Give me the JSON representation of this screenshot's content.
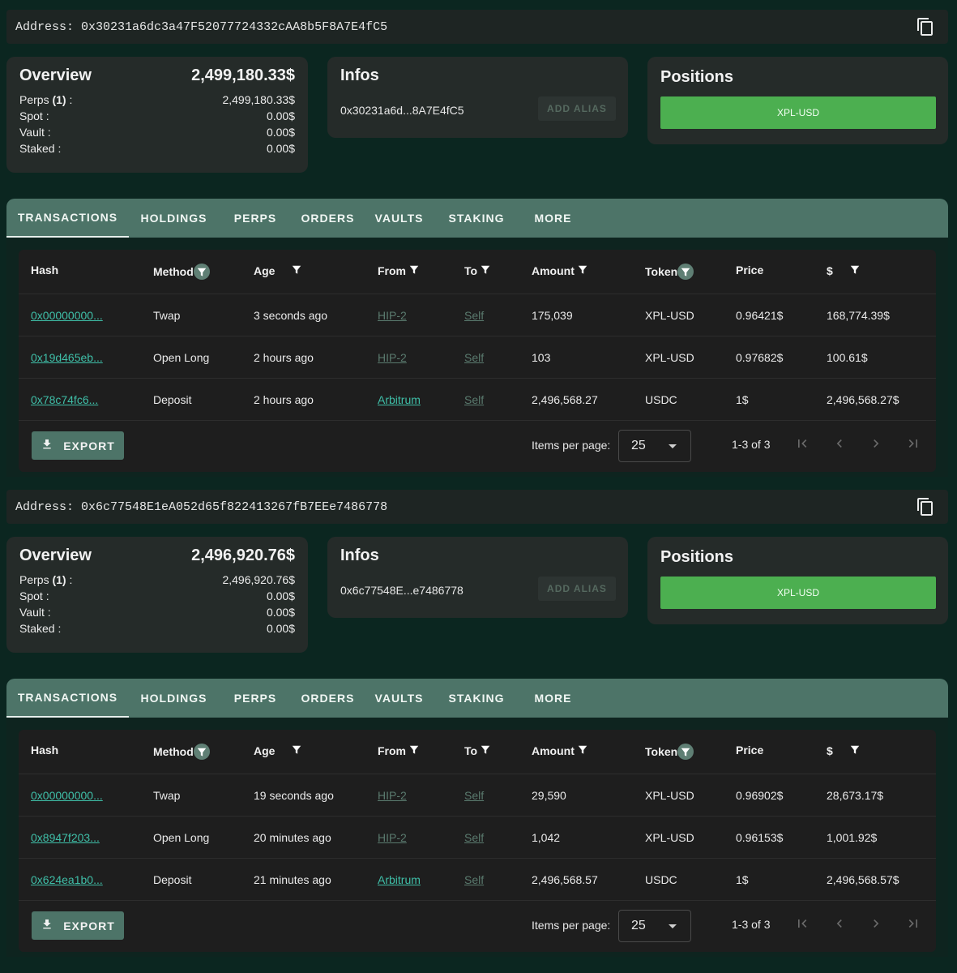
{
  "colors": {
    "accent": "#4d7468",
    "positions_green": "#4caf50",
    "link": "#3fbfa8",
    "amount": "#1e8a2e"
  },
  "tabs": [
    "TRANSACTIONS",
    "HOLDINGS",
    "PERPS",
    "ORDERS",
    "VAULTS",
    "STAKING",
    "MORE"
  ],
  "columns": [
    "Hash",
    "Method",
    "Age",
    "From",
    "To",
    "Amount",
    "Token",
    "Price",
    "$"
  ],
  "labels": {
    "address_prefix": "Address:",
    "overview": "Overview",
    "infos": "Infos",
    "positions": "Positions",
    "perps": "Perps",
    "perps_count": "(1)",
    "perps_colon": ":",
    "spot": "Spot :",
    "vault": "Vault :",
    "staked": "Staked :",
    "add_alias": "ADD ALIAS",
    "export": "EXPORT",
    "items_per_page": "Items per page:"
  },
  "accounts": [
    {
      "address": "0x30231a6dc3a47F52077724332cAA8b5F8A7E4fC5",
      "short_address": "0x30231a6d...8A7E4fC5",
      "total": "2,499,180.33$",
      "perps": "2,499,180.33$",
      "spot": "0.00$",
      "vault": "0.00$",
      "staked": "0.00$",
      "position": "XPL-USD",
      "items_per_page": "25",
      "range": "1-3 of 3",
      "transactions": [
        {
          "hash": "0x00000000...",
          "method": "Twap",
          "age": "3 seconds ago",
          "from": "HIP-2",
          "to": "Self",
          "amount": "175,039",
          "token": "XPL-USD",
          "price": "0.96421$",
          "usd": "168,774.39$"
        },
        {
          "hash": "0x19d465eb...",
          "method": "Open Long",
          "age": "2 hours ago",
          "from": "HIP-2",
          "to": "Self",
          "amount": "103",
          "token": "XPL-USD",
          "price": "0.97682$",
          "usd": "100.61$"
        },
        {
          "hash": "0x78c74fc6...",
          "method": "Deposit",
          "age": "2 hours ago",
          "from": "Arbitrum",
          "to": "Self",
          "amount": "2,496,568.27",
          "token": "USDC",
          "price": "1$",
          "usd": "2,496,568.27$"
        }
      ]
    },
    {
      "address": "0x6c77548E1eA052d65f822413267fB7EEe7486778",
      "short_address": "0x6c77548E...e7486778",
      "total": "2,496,920.76$",
      "perps": "2,496,920.76$",
      "spot": "0.00$",
      "vault": "0.00$",
      "staked": "0.00$",
      "position": "XPL-USD",
      "items_per_page": "25",
      "range": "1-3 of 3",
      "transactions": [
        {
          "hash": "0x00000000...",
          "method": "Twap",
          "age": "19 seconds ago",
          "from": "HIP-2",
          "to": "Self",
          "amount": "29,590",
          "token": "XPL-USD",
          "price": "0.96902$",
          "usd": "28,673.17$"
        },
        {
          "hash": "0x8947f203...",
          "method": "Open Long",
          "age": "20 minutes ago",
          "from": "HIP-2",
          "to": "Self",
          "amount": "1,042",
          "token": "XPL-USD",
          "price": "0.96153$",
          "usd": "1,001.92$"
        },
        {
          "hash": "0x624ea1b0...",
          "method": "Deposit",
          "age": "21 minutes ago",
          "from": "Arbitrum",
          "to": "Self",
          "amount": "2,496,568.57",
          "token": "USDC",
          "price": "1$",
          "usd": "2,496,568.57$"
        }
      ]
    }
  ]
}
